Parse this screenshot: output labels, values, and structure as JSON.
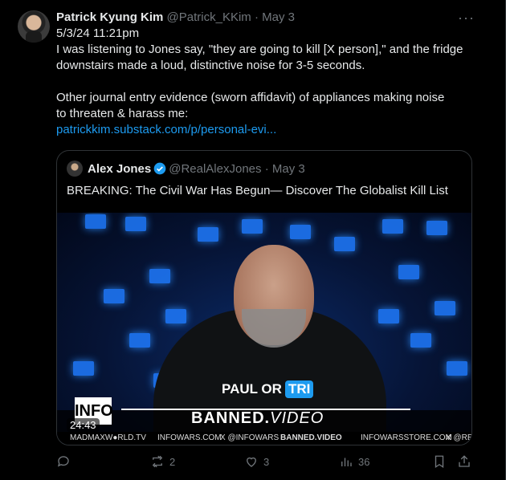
{
  "post": {
    "author_name": "Patrick Kyung Kim",
    "author_handle": "@Patrick_KKim",
    "separator": "·",
    "date": "May 3",
    "more": "···",
    "line1": "5/3/24 11:21pm",
    "line2": "I was listening to Jones say, \"they are going to kill [X person],\" and the fridge",
    "line3": "downstairs made a loud, distinctive noise for 3-5 seconds.",
    "line4": "Other journal entry evidence (sworn affidavit) of appliances making noise",
    "line5": "to threaten & harass me:",
    "link": "patrickkim.substack.com/p/personal-evi..."
  },
  "quote": {
    "author_name": "Alex Jones",
    "author_handle": "@RealAlexJones",
    "separator": "·",
    "date": "May 3",
    "text": "BREAKING: The Civil War Has Begun— Discover The Globalist Kill List",
    "video": {
      "overlay_text": "PAUL OR",
      "overlay_highlight": "TRI",
      "banner_main": "BANNED.",
      "banner_italic": "VIDEO",
      "logo": "INFO",
      "duration": "24:43",
      "footer": [
        "MADMAXW●RLD.TV",
        "INFOWARS.COM",
        "X @INFOWARS",
        "BANNED.VIDEO",
        "INFOWARSSTORE.COM",
        "X @RE"
      ]
    }
  },
  "actions": {
    "replies": "",
    "reposts": "2",
    "likes": "3",
    "views": "36"
  },
  "colors": {
    "accent": "#1d9bf0",
    "muted": "#71767b",
    "text": "#e7e9ea",
    "background": "#000000"
  }
}
